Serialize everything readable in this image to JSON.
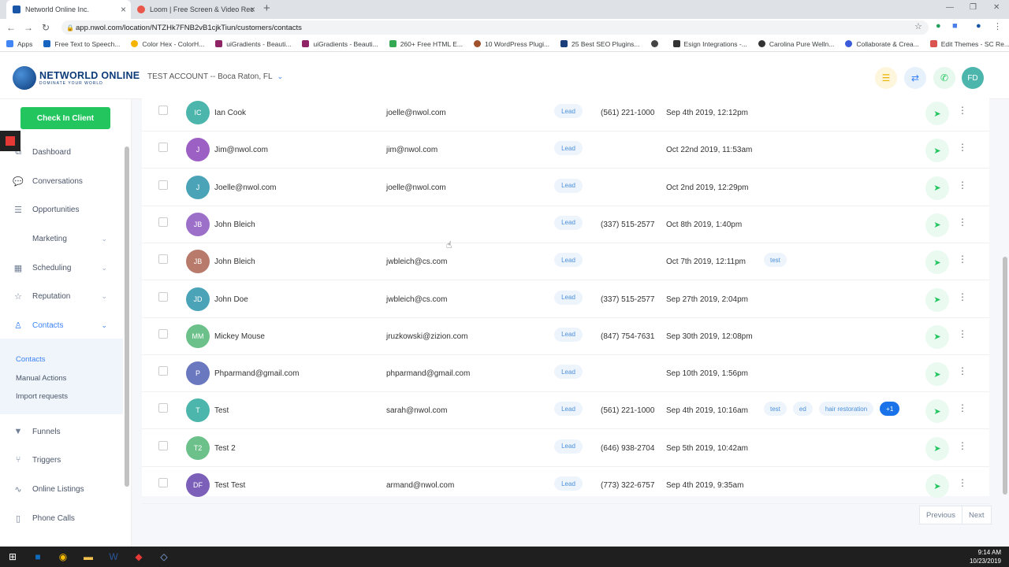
{
  "browser": {
    "tabs": [
      {
        "title": "Networld Online Inc.",
        "active": true
      },
      {
        "title": "Loom | Free Screen & Video Rec",
        "active": false
      }
    ],
    "url": "app.nwol.com/location/NTZHk7FNB2vB1cjkTiun/customers/contacts",
    "bookmarks": [
      "Apps",
      "Free Text to Speech...",
      "Color Hex - ColorH...",
      "uiGradients - Beauti...",
      "uiGradients - Beauti...",
      "260+ Free HTML E...",
      "10 WordPress Plugi...",
      "25 Best SEO Plugins...",
      "",
      "Esign Integrations -...",
      "Carolina Pure Welln...",
      "Collaborate & Crea...",
      "Edit Themes - SC Re..."
    ]
  },
  "header": {
    "logo_text": "NETWORLD ONLINE",
    "logo_sub": "DOMINATE YOUR WORLD",
    "account": "TEST ACCOUNT -- Boca Raton, FL",
    "user_initials": "FD"
  },
  "sidebar": {
    "checkin_label": "Check In Client",
    "items": [
      "Dashboard",
      "Conversations",
      "Opportunities",
      "Marketing",
      "Scheduling",
      "Reputation",
      "Contacts",
      "Funnels",
      "Triggers",
      "Online Listings",
      "Phone Calls"
    ],
    "subitems": [
      "Contacts",
      "Manual Actions",
      "Import requests"
    ]
  },
  "contacts": [
    {
      "initials": "IC",
      "name": "Ian Cook",
      "email": "joelle@nwol.com",
      "type": "Lead",
      "phone": "(561) 221-1000",
      "date": "Sep 4th 2019, 12:12pm",
      "tags": [],
      "color": "#4db6ac"
    },
    {
      "initials": "J",
      "name": "Jim@nwol.com",
      "email": "jim@nwol.com",
      "type": "Lead",
      "phone": "",
      "date": "Oct 22nd 2019, 11:53am",
      "tags": [],
      "color": "#9c5fc4"
    },
    {
      "initials": "J",
      "name": "Joelle@nwol.com",
      "email": "joelle@nwol.com",
      "type": "Lead",
      "phone": "",
      "date": "Oct 2nd 2019, 12:29pm",
      "tags": [],
      "color": "#4ba3b8"
    },
    {
      "initials": "JB",
      "name": "John Bleich",
      "email": "",
      "type": "Lead",
      "phone": "(337) 515-2577",
      "date": "Oct 8th 2019, 1:40pm",
      "tags": [],
      "color": "#9c6fc9"
    },
    {
      "initials": "JB",
      "name": "John Bleich",
      "email": "jwbleich@cs.com",
      "type": "Lead",
      "phone": "",
      "date": "Oct 7th 2019, 12:11pm",
      "tags": [
        "test"
      ],
      "color": "#b87a6a"
    },
    {
      "initials": "JD",
      "name": "John Doe",
      "email": "jwbleich@cs.com",
      "type": "Lead",
      "phone": "(337) 515-2577",
      "date": "Sep 27th 2019, 2:04pm",
      "tags": [],
      "color": "#4ba3b8"
    },
    {
      "initials": "MM",
      "name": "Mickey Mouse",
      "email": "jruzkowski@zizion.com",
      "type": "Lead",
      "phone": "(847) 754-7631",
      "date": "Sep 30th 2019, 12:08pm",
      "tags": [],
      "color": "#6cc08a"
    },
    {
      "initials": "P",
      "name": "Phparmand@gmail.com",
      "email": "phparmand@gmail.com",
      "type": "Lead",
      "phone": "",
      "date": "Sep 10th 2019, 1:56pm",
      "tags": [],
      "color": "#6a78c0"
    },
    {
      "initials": "T",
      "name": "Test",
      "email": "sarah@nwol.com",
      "type": "Lead",
      "phone": "(561) 221-1000",
      "date": "Sep 4th 2019, 10:16am",
      "tags": [
        "test",
        "ed",
        "hair restoration",
        "+1"
      ],
      "color": "#4db6ac"
    },
    {
      "initials": "T2",
      "name": "Test 2",
      "email": "",
      "type": "Lead",
      "phone": "(646) 938-2704",
      "date": "Sep 5th 2019, 10:42am",
      "tags": [],
      "color": "#6cc08a"
    },
    {
      "initials": "DF",
      "name": "Test Test",
      "email": "armand@nwol.com",
      "type": "Lead",
      "phone": "(773) 322-6757",
      "date": "Sep 4th 2019, 9:35am",
      "tags": [],
      "color": "#7b5fb8"
    }
  ],
  "pager": {
    "prev": "Previous",
    "next": "Next"
  },
  "taskbar": {
    "time": "9:14 AM",
    "date": "10/23/2019"
  }
}
